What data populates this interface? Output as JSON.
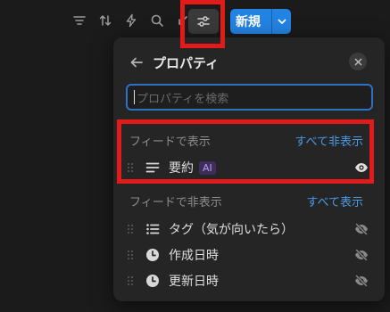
{
  "toolbar": {
    "icons": [
      "filter-icon",
      "sort-icon",
      "lightning-icon",
      "search-icon",
      "arrow-icon",
      "properties-icon"
    ],
    "new_button_label": "新規"
  },
  "panel": {
    "title": "プロパティ",
    "search_placeholder": "プロパティを検索",
    "shown_section": {
      "label": "フィードで表示",
      "action": "すべて非表示",
      "items": [
        {
          "label": "要約",
          "badge": "AI",
          "icon": "text-lines-icon",
          "visible": true
        }
      ]
    },
    "hidden_section": {
      "label": "フィードで非表示",
      "action": "すべて表示",
      "items": [
        {
          "label": "タグ（気が向いたら）",
          "icon": "list-icon",
          "visible": false
        },
        {
          "label": "作成日時",
          "icon": "clock-icon",
          "visible": false
        },
        {
          "label": "更新日時",
          "icon": "clock-icon",
          "visible": false
        }
      ]
    }
  },
  "colors": {
    "accent": "#2383e2",
    "link": "#4a9ae6",
    "highlight": "#e21a1a",
    "panel_bg": "#252525",
    "page_bg": "#1b1b1b"
  }
}
